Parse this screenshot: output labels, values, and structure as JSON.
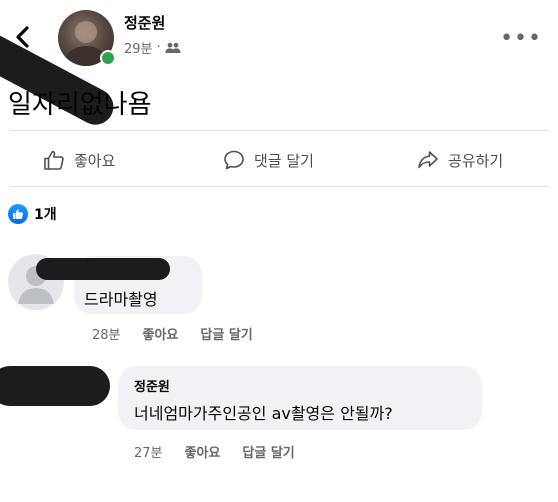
{
  "header": {
    "author": "정준원",
    "time": "29분",
    "separator": "·",
    "audience_icon": "friends-icon",
    "more_label": "•••"
  },
  "post": {
    "text": "일자리없나욤"
  },
  "actions": {
    "like_label": "좋아요",
    "comment_label": "댓글 달기",
    "share_label": "공유하기"
  },
  "reactions": {
    "count_label": "1개"
  },
  "comments": [
    {
      "text": "드라마촬영",
      "time": "28분",
      "like_label": "좋아요",
      "reply_label": "답글 달기"
    },
    {
      "author": "정준원",
      "text": "너네엄마가주인공인 av촬영은 안될까?",
      "time": "27분",
      "like_label": "좋아요",
      "reply_label": "답글 달기"
    }
  ],
  "colors": {
    "accent": "#1877f2",
    "muted_text": "#65676b",
    "bubble_bg": "#f0f2f5",
    "online": "#31a24c"
  }
}
